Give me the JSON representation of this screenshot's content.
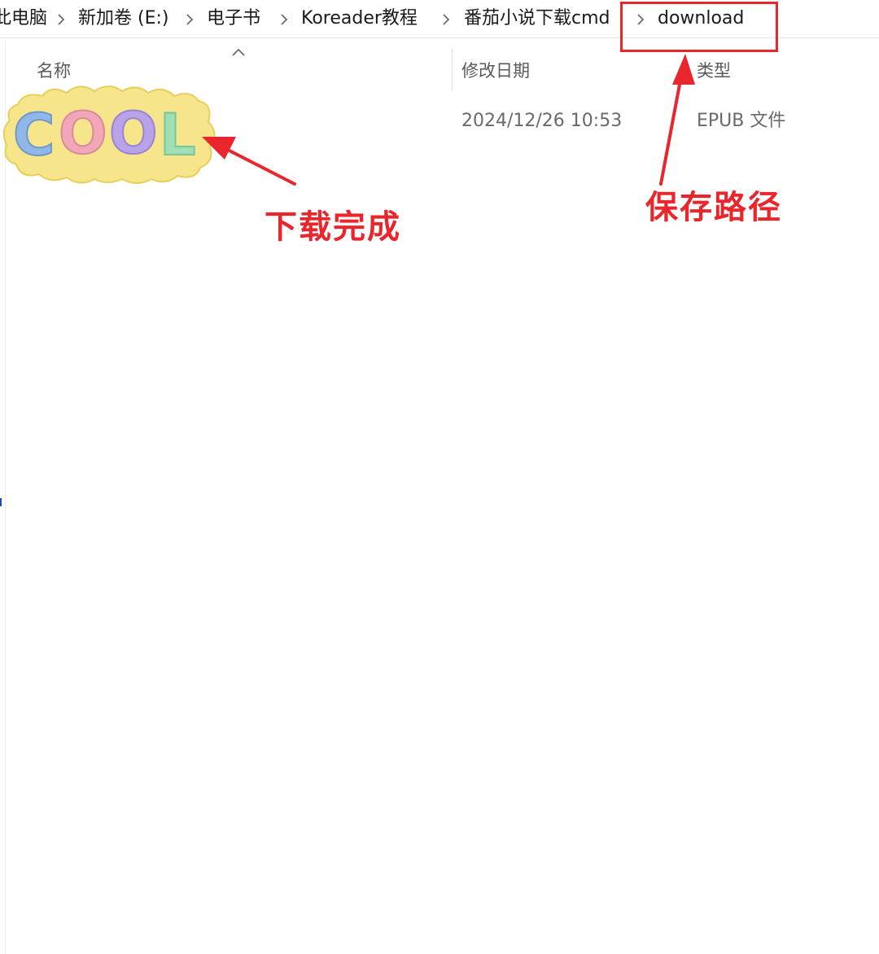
{
  "breadcrumb": {
    "items": [
      {
        "label": "此电脑"
      },
      {
        "label": "新加卷 (E:)"
      },
      {
        "label": "电子书"
      },
      {
        "label": "Koreader教程"
      },
      {
        "label": "番茄小说下载cmd"
      },
      {
        "label": "download"
      }
    ]
  },
  "columns": {
    "name": "名称",
    "modified": "修改日期",
    "type": "类型"
  },
  "file": {
    "modified": "2024/12/26 10:53",
    "type": "EPUB 文件",
    "art_text": "COOL",
    "art_colors": {
      "blob": "#f6e58a",
      "c": "#8fb8e8",
      "o1": "#f2a7b8",
      "o2": "#b8a3ea",
      "l": "#9edfb5"
    }
  },
  "annotations": {
    "download_done": "下载完成",
    "save_path": "保存路径",
    "color": "#e8262b"
  }
}
